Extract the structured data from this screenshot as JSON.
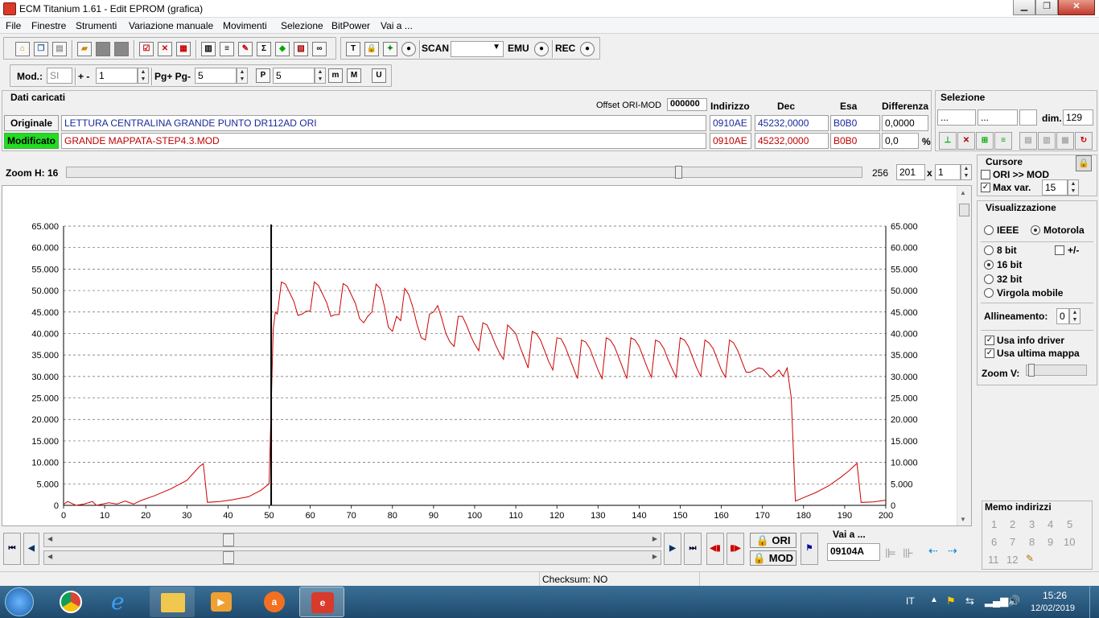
{
  "window": {
    "title": "ECM Titanium 1.61 - Edit EPROM (grafica)"
  },
  "menu": [
    "File",
    "Finestre",
    "Strumenti",
    "Variazione manuale",
    "Movimenti",
    "Selezione",
    "BitPower",
    "Vai a ..."
  ],
  "toolbar": {
    "scan_label": "SCAN",
    "emu_label": "EMU",
    "rec_label": "REC"
  },
  "toolbar2": {
    "mod_label": "Mod.:",
    "mod_value": "SI",
    "plusminus_label": "+ -",
    "step_value": "1",
    "pg_label": "Pg+ Pg-",
    "pg_value": "5",
    "p_value": "5"
  },
  "dati": {
    "title": "Dati caricati",
    "offset_label": "Offset ORI-MOD",
    "offset_value": "000000",
    "col_indirizzo": "Indirizzo",
    "col_dec": "Dec",
    "col_esa": "Esa",
    "col_diff": "Differenza",
    "originale_label": "Originale",
    "modificato_label": "Modificato",
    "ori_name": "LETTURA CENTRALINA GRANDE PUNTO DR112AD ORI",
    "ori_addr": "0910AE",
    "ori_dec": "45232,0000",
    "ori_esa": "B0B0",
    "ori_diff": "0,0000",
    "mod_name": "GRANDE MAPPATA-STEP4.3.MOD",
    "mod_addr": "0910AE",
    "mod_dec": "45232,0000",
    "mod_esa": "B0B0",
    "mod_diff": "0,0",
    "percent": "%"
  },
  "selezione": {
    "title": "Selezione",
    "f1": "...",
    "f2": "...",
    "dim_label": "dim.",
    "dim_value": "129"
  },
  "zoom": {
    "label": "Zoom H: 16",
    "max": "256",
    "val": "201",
    "x": "x",
    "mult": "1"
  },
  "cursore": {
    "title": "Cursore",
    "ori_mod": "ORI >> MOD",
    "max_var": "Max var.",
    "max_var_value": "15"
  },
  "vis": {
    "title": "Visualizzazione",
    "ieee": "IEEE",
    "motorola": "Motorola",
    "b8": "8 bit",
    "pm": "+/-",
    "b16": "16 bit",
    "b32": "32 bit",
    "virgola": "Virgola mobile",
    "allineamento": "Allineamento:",
    "allin_value": "0",
    "usa_info": "Usa info driver",
    "usa_ultima": "Usa ultima mappa",
    "zoomv": "Zoom V:"
  },
  "memo": {
    "title": "Memo indirizzi",
    "nums": [
      "1",
      "2",
      "3",
      "4",
      "5",
      "6",
      "7",
      "8",
      "9",
      "10",
      "11",
      "12"
    ]
  },
  "nav": {
    "ori_btn": "ORI",
    "mod_btn": "MOD",
    "vai_label": "Vai a ...",
    "vai_value": "09104A"
  },
  "status": {
    "checksum": "Checksum: NO"
  },
  "taskbar": {
    "lang": "IT",
    "time": "15:26",
    "date": "12/02/2019"
  },
  "chart_data": {
    "type": "line",
    "xlim": [
      0,
      200
    ],
    "ylim": [
      0,
      65000
    ],
    "x_ticks": [
      0,
      10,
      20,
      30,
      40,
      50,
      60,
      70,
      80,
      90,
      100,
      110,
      120,
      130,
      140,
      150,
      160,
      170,
      180,
      190,
      200
    ],
    "y_ticks": [
      "0",
      "5.000",
      "10.000",
      "15.000",
      "20.000",
      "25.000",
      "30.000",
      "35.000",
      "40.000",
      "45.000",
      "50.000",
      "55.000",
      "60.000",
      "65.000"
    ],
    "grid": true,
    "cursor_x": 50.5,
    "series": [
      {
        "color": "#cc0000",
        "points": [
          [
            0,
            200
          ],
          [
            1,
            900
          ],
          [
            3,
            0
          ],
          [
            5,
            300
          ],
          [
            7,
            900
          ],
          [
            8,
            0
          ],
          [
            11,
            600
          ],
          [
            13,
            300
          ],
          [
            15,
            1000
          ],
          [
            17,
            300
          ],
          [
            19,
            1200
          ],
          [
            22,
            2200
          ],
          [
            26,
            3800
          ],
          [
            30,
            5800
          ],
          [
            33,
            9000
          ],
          [
            34,
            9700
          ],
          [
            35,
            700
          ],
          [
            38,
            900
          ],
          [
            41,
            1300
          ],
          [
            45,
            2000
          ],
          [
            48,
            3500
          ],
          [
            50,
            5000
          ],
          [
            51,
            41000
          ],
          [
            51.5,
            45000
          ],
          [
            52,
            44500
          ],
          [
            53,
            52000
          ],
          [
            54,
            51500
          ],
          [
            56,
            47500
          ],
          [
            57,
            44200
          ],
          [
            58,
            44500
          ],
          [
            59,
            45200
          ],
          [
            60,
            45200
          ],
          [
            61,
            52000
          ],
          [
            62,
            51200
          ],
          [
            64,
            47200
          ],
          [
            65,
            44000
          ],
          [
            66,
            44400
          ],
          [
            67,
            44400
          ],
          [
            68,
            51600
          ],
          [
            69,
            51000
          ],
          [
            71,
            47000
          ],
          [
            72,
            43500
          ],
          [
            73,
            42500
          ],
          [
            74,
            44000
          ],
          [
            75,
            45000
          ],
          [
            76,
            51500
          ],
          [
            77,
            50500
          ],
          [
            78,
            46500
          ],
          [
            79,
            41500
          ],
          [
            80,
            40500
          ],
          [
            81,
            44000
          ],
          [
            82,
            43000
          ],
          [
            83,
            50500
          ],
          [
            84,
            49000
          ],
          [
            85,
            46000
          ],
          [
            86,
            42000
          ],
          [
            87,
            39000
          ],
          [
            88,
            38500
          ],
          [
            89,
            44500
          ],
          [
            90,
            45000
          ],
          [
            91,
            46500
          ],
          [
            92,
            43500
          ],
          [
            93,
            40000
          ],
          [
            94,
            38000
          ],
          [
            95,
            37000
          ],
          [
            96,
            44000
          ],
          [
            97,
            44000
          ],
          [
            98,
            42000
          ],
          [
            99,
            39500
          ],
          [
            100,
            37500
          ],
          [
            101,
            36000
          ],
          [
            102,
            42500
          ],
          [
            103,
            42000
          ],
          [
            104,
            40000
          ],
          [
            105,
            37500
          ],
          [
            106,
            35500
          ],
          [
            107,
            34000
          ],
          [
            108,
            42000
          ],
          [
            109,
            41000
          ],
          [
            110,
            40000
          ],
          [
            111,
            37000
          ],
          [
            112,
            34500
          ],
          [
            113,
            32000
          ],
          [
            114,
            40500
          ],
          [
            115,
            40000
          ],
          [
            116,
            38500
          ],
          [
            117,
            36000
          ],
          [
            118,
            33500
          ],
          [
            119,
            31500
          ],
          [
            120,
            39000
          ],
          [
            121,
            38800
          ],
          [
            122,
            37000
          ],
          [
            123,
            34500
          ],
          [
            124,
            32000
          ],
          [
            125,
            29500
          ],
          [
            126,
            38500
          ],
          [
            127,
            38000
          ],
          [
            128,
            36500
          ],
          [
            129,
            34000
          ],
          [
            130,
            31500
          ],
          [
            131,
            29500
          ],
          [
            132,
            39000
          ],
          [
            133,
            38500
          ],
          [
            134,
            37000
          ],
          [
            135,
            34500
          ],
          [
            136,
            32000
          ],
          [
            137,
            29500
          ],
          [
            138,
            39000
          ],
          [
            139,
            38500
          ],
          [
            140,
            37000
          ],
          [
            141,
            34500
          ],
          [
            142,
            32000
          ],
          [
            143,
            29800
          ],
          [
            144,
            38500
          ],
          [
            145,
            38000
          ],
          [
            146,
            36500
          ],
          [
            147,
            34000
          ],
          [
            148,
            31800
          ],
          [
            149,
            29800
          ],
          [
            150,
            39000
          ],
          [
            151,
            38500
          ],
          [
            152,
            37000
          ],
          [
            153,
            34500
          ],
          [
            154,
            32000
          ],
          [
            155,
            30000
          ],
          [
            156,
            38500
          ],
          [
            157,
            37800
          ],
          [
            158,
            36500
          ],
          [
            159,
            34000
          ],
          [
            160,
            31500
          ],
          [
            161,
            29800
          ],
          [
            162,
            38500
          ],
          [
            163,
            37800
          ],
          [
            164,
            36000
          ],
          [
            165,
            33500
          ],
          [
            166,
            31000
          ],
          [
            167,
            31000
          ],
          [
            168,
            31500
          ],
          [
            169,
            32000
          ],
          [
            170,
            31800
          ],
          [
            172,
            29800
          ],
          [
            173,
            30500
          ],
          [
            174,
            31500
          ],
          [
            175,
            30000
          ],
          [
            176,
            32000
          ],
          [
            177,
            25000
          ],
          [
            178,
            1000
          ],
          [
            180,
            1800
          ],
          [
            183,
            3000
          ],
          [
            186,
            4500
          ],
          [
            189,
            6500
          ],
          [
            191,
            8000
          ],
          [
            193,
            9800
          ],
          [
            194,
            700
          ],
          [
            197,
            800
          ],
          [
            200,
            1200
          ]
        ]
      }
    ]
  }
}
